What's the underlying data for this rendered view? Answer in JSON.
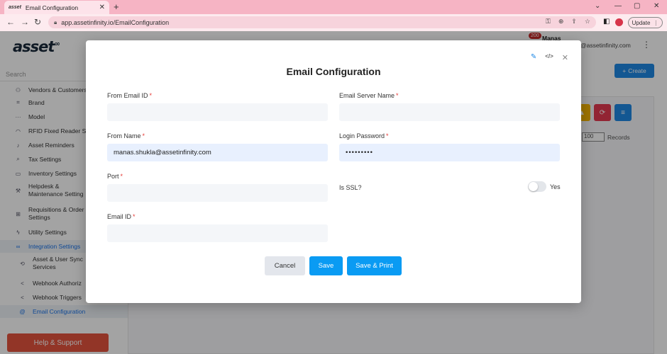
{
  "browser": {
    "tab_title": "Email Configuration",
    "tab_favicon": "asset",
    "url": "app.assetinfinity.io/EmailConfiguration",
    "update_label": "Update"
  },
  "app": {
    "logo": "asset",
    "logo_super": "∞",
    "search_placeholder": "Search",
    "user_name": "Manas",
    "notification_count": "200",
    "user_email": "@assetinfinity.com",
    "create_label": "Create",
    "records_value": "100",
    "records_label": "Records",
    "help_label": "Help & Support",
    "sidebar": [
      {
        "label": "Vendors & Customers",
        "icon": "user-group-icon"
      },
      {
        "label": "Brand",
        "icon": "tag-icon"
      },
      {
        "label": "Model",
        "icon": "dots-icon"
      },
      {
        "label": "RFID Fixed Reader Se",
        "icon": "wifi-icon"
      },
      {
        "label": "Asset Reminders",
        "icon": "bell-icon"
      },
      {
        "label": "Tax Settings",
        "icon": "search-dollar-icon"
      },
      {
        "label": "Inventory Settings",
        "icon": "box-icon"
      },
      {
        "label": "Helpdesk & Maintenance Setting",
        "icon": "wrench-icon"
      },
      {
        "label": "Requisitions & Order Settings",
        "icon": "cart-icon"
      },
      {
        "label": "Utility Settings",
        "icon": "bolt-icon"
      },
      {
        "label": "Integration Settings",
        "icon": "link-icon"
      },
      {
        "label": "Asset & User Sync Services",
        "icon": "sync-icon"
      },
      {
        "label": "Webhook Authoriz",
        "icon": "share-icon"
      },
      {
        "label": "Webhook Triggers",
        "icon": "share-icon"
      },
      {
        "label": "Email Configuration",
        "icon": "at-icon"
      }
    ]
  },
  "modal": {
    "title": "Email Configuration",
    "fields": {
      "from_email_id": {
        "label": "From Email ID",
        "value": ""
      },
      "email_server_name": {
        "label": "Email Server Name",
        "value": ""
      },
      "from_name": {
        "label": "From Name",
        "value": "manas.shukla@assetinfinity.com"
      },
      "login_password": {
        "label": "Login Password",
        "value": "•••••••••"
      },
      "port": {
        "label": "Port",
        "value": ""
      },
      "is_ssl": {
        "label": "Is SSL?",
        "toggle_label": "Yes",
        "checked": false
      },
      "email_id": {
        "label": "Email ID",
        "value": ""
      }
    },
    "required_mark": "*",
    "buttons": {
      "cancel": "Cancel",
      "save": "Save",
      "save_print": "Save & Print"
    }
  },
  "colors": {
    "tabbar": "#f6b4c4",
    "primary": "#0a9bf3",
    "required": "#e53935",
    "help": "#e5533d"
  }
}
